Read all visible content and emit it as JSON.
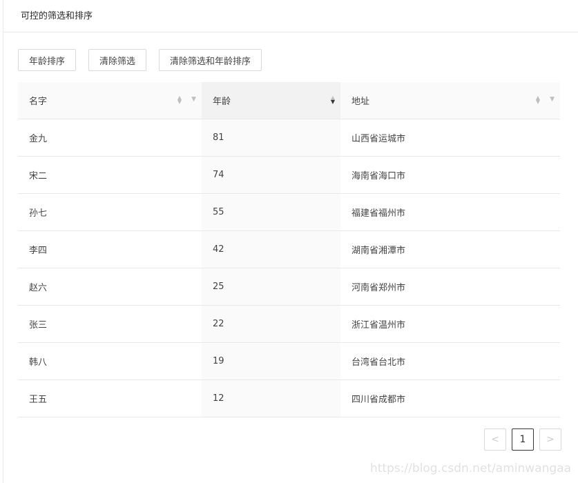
{
  "card": {
    "title": "可控的筛选和排序"
  },
  "buttons": {
    "sort_age": "年龄排序",
    "clear_filters": "清除筛选",
    "clear_all": "清除筛选和年龄排序"
  },
  "columns": [
    "名字",
    "年龄",
    "地址"
  ],
  "rows": [
    [
      "金九",
      "81",
      "山西省运城市"
    ],
    [
      "宋二",
      "74",
      "海南省海口市"
    ],
    [
      "孙七",
      "55",
      "福建省福州市"
    ],
    [
      "李四",
      "42",
      "湖南省湘潭市"
    ],
    [
      "赵六",
      "25",
      "河南省郑州市"
    ],
    [
      "张三",
      "22",
      "浙江省温州市"
    ],
    [
      "韩八",
      "19",
      "台湾省台北市"
    ],
    [
      "王五",
      "12",
      "四川省成都市"
    ]
  ],
  "pagination": {
    "current": "1",
    "prev": "<",
    "next": ">"
  },
  "watermark": "https://blog.csdn.net/aminwangaa"
}
